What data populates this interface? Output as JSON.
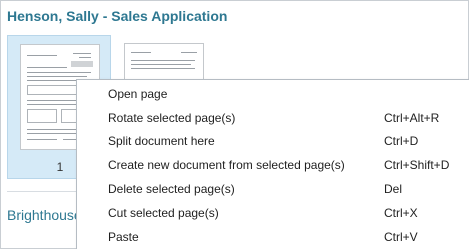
{
  "document_title": "Henson, Sally - Sales Application",
  "next_document_title": "Brighthouse",
  "thumbnails": [
    {
      "page_number": "1",
      "selected": true
    },
    {
      "page_number": "",
      "selected": false
    }
  ],
  "context_menu": {
    "items": [
      {
        "label": "Open page",
        "shortcut": ""
      },
      {
        "label": "Rotate selected page(s)",
        "shortcut": "Ctrl+Alt+R"
      },
      {
        "label": "Split document here",
        "shortcut": "Ctrl+D"
      },
      {
        "label": "Create new document from selected page(s)",
        "shortcut": "Ctrl+Shift+D"
      },
      {
        "label": "Delete selected page(s)",
        "shortcut": "Del"
      },
      {
        "label": "Cut selected page(s)",
        "shortcut": "Ctrl+X"
      },
      {
        "label": "Paste",
        "shortcut": "Ctrl+V"
      }
    ]
  },
  "colors": {
    "title": "#2e7891",
    "selection_background": "#d5eaf7"
  }
}
